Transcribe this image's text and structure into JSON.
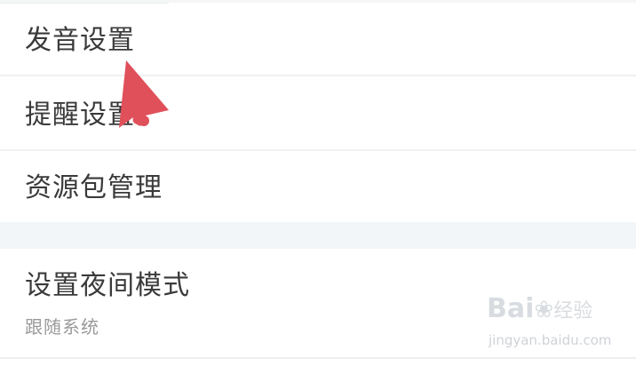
{
  "settings": {
    "items": [
      {
        "label": "发音设置"
      },
      {
        "label": "提醒设置"
      },
      {
        "label": "资源包管理"
      }
    ],
    "night_mode": {
      "label": "设置夜间模式",
      "value": "跟随系统"
    }
  },
  "watermark": {
    "logo_text": "Bai",
    "logo_after": "经验",
    "url": "jingyan.baidu.com"
  },
  "colors": {
    "arrow": "#e0505a",
    "section_gap": "#f3f6f9",
    "label_text": "#3a3a3a",
    "secondary_text": "#9a9a9a"
  },
  "icons": {
    "pointer": "red-arrow-pointer-icon",
    "watermark_paw": "baidu-paw-icon"
  }
}
